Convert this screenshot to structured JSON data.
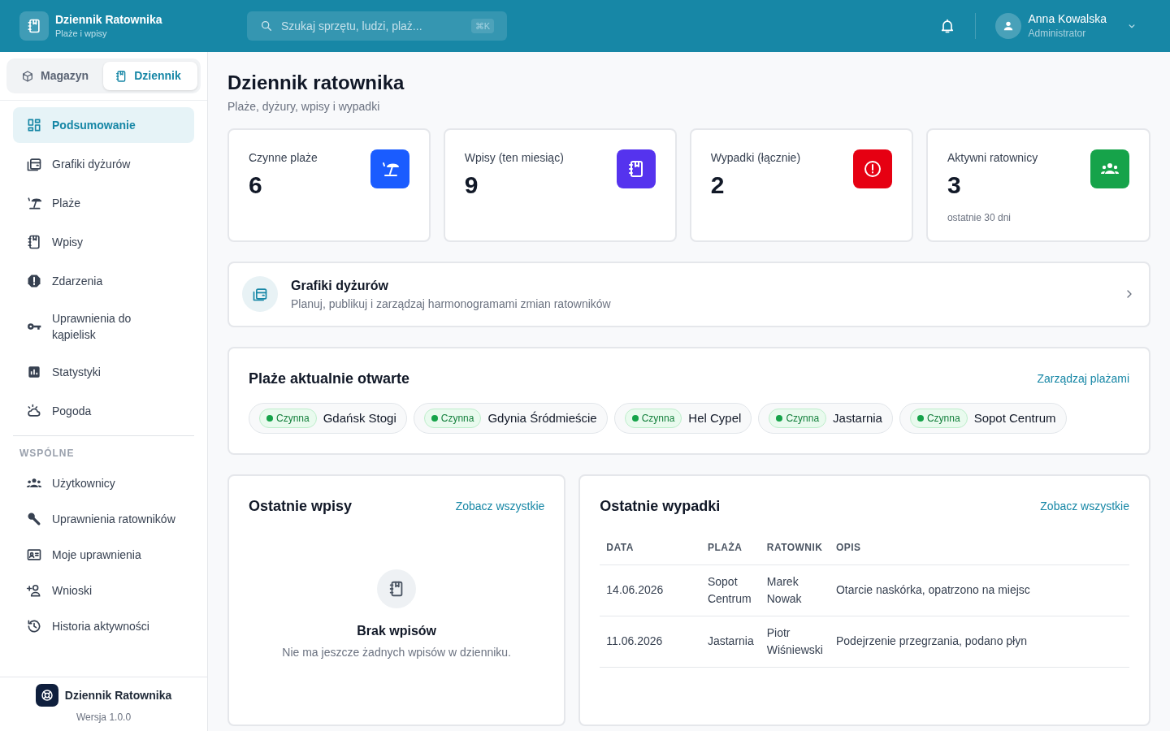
{
  "app": {
    "title": "Dziennik Ratownika",
    "subtitle": "Plaże i wpisy"
  },
  "search": {
    "placeholder": "Szukaj sprzętu, ludzi, plaż...",
    "shortcut": "⌘K"
  },
  "user": {
    "name": "Anna Kowalska",
    "role": "Administrator"
  },
  "switcher": [
    {
      "label": "Magazyn",
      "selected": false
    },
    {
      "label": "Dziennik",
      "selected": true
    }
  ],
  "nav": [
    {
      "label": "Podsumowanie",
      "selected": true
    },
    {
      "label": "Grafiki dyżurów",
      "selected": false
    },
    {
      "label": "Plaże",
      "selected": false
    },
    {
      "label": "Wpisy",
      "selected": false
    },
    {
      "label": "Zdarzenia",
      "selected": false
    },
    {
      "label": "Uprawnienia do kąpielisk",
      "selected": false
    },
    {
      "label": "Statystyki",
      "selected": false
    },
    {
      "label": "Pogoda",
      "selected": false
    }
  ],
  "shared_section": {
    "heading": "WSPÓLNE",
    "items": [
      {
        "label": "Użytkownicy",
        "selected": false
      },
      {
        "label": "Uprawnienia ratowników",
        "selected": false
      },
      {
        "label": "Moje uprawnienia",
        "selected": false
      },
      {
        "label": "Wnioski",
        "selected": false
      },
      {
        "label": "Historia aktywności",
        "selected": false
      }
    ]
  },
  "sidebar_footer": {
    "name": "Dziennik Ratownika",
    "version": "Wersja 1.0.0"
  },
  "page": {
    "title": "Dziennik ratownika",
    "subtitle": "Plaże, dyżury, wpisy i wypadki"
  },
  "stats": [
    {
      "label": "Czynne plaże",
      "value": "6",
      "color": "#1a5cff"
    },
    {
      "label": "Wpisy (ten miesiąc)",
      "value": "9",
      "color": "#5533ee"
    },
    {
      "label": "Wypadki (łącznie)",
      "value": "2",
      "color": "#e60012"
    },
    {
      "label": "Aktywni ratownicy",
      "value": "3",
      "note": "ostatnie 30 dni",
      "color": "#16a34a"
    }
  ],
  "schedule_card": {
    "title": "Grafiki dyżurów",
    "description": "Planuj, publikuj i zarządzaj harmonogramami zmian ratowników"
  },
  "open_beaches": {
    "title": "Plaże aktualnie otwarte",
    "link": "Zarządzaj plażami",
    "beaches": [
      {
        "status": "Czynna",
        "name": "Gdańsk Stogi"
      },
      {
        "status": "Czynna",
        "name": "Gdynia Śródmieście"
      },
      {
        "status": "Czynna",
        "name": "Hel Cypel"
      },
      {
        "status": "Czynna",
        "name": "Jastarnia"
      },
      {
        "status": "Czynna",
        "name": "Sopot Centrum"
      }
    ]
  },
  "recent_entries": {
    "title": "Ostatnie wpisy",
    "link": "Zobacz wszystkie",
    "empty_title": "Brak wpisów",
    "empty_text": "Nie ma jeszcze żadnych wpisów w dzienniku."
  },
  "recent_accidents": {
    "title": "Ostatnie wypadki",
    "link": "Zobacz wszystkie",
    "columns": [
      "DATA",
      "PLAŻA",
      "RATOWNIK",
      "OPIS"
    ],
    "rows": [
      [
        "14.06.2026",
        "Sopot Centrum",
        "Marek Nowak",
        "Otarcie naskórka, opatrzono na miejsc"
      ],
      [
        "11.06.2026",
        "Jastarnia",
        "Piotr Wiśniewski",
        "Podejrzenie przegrzania, podano płyn"
      ]
    ]
  }
}
